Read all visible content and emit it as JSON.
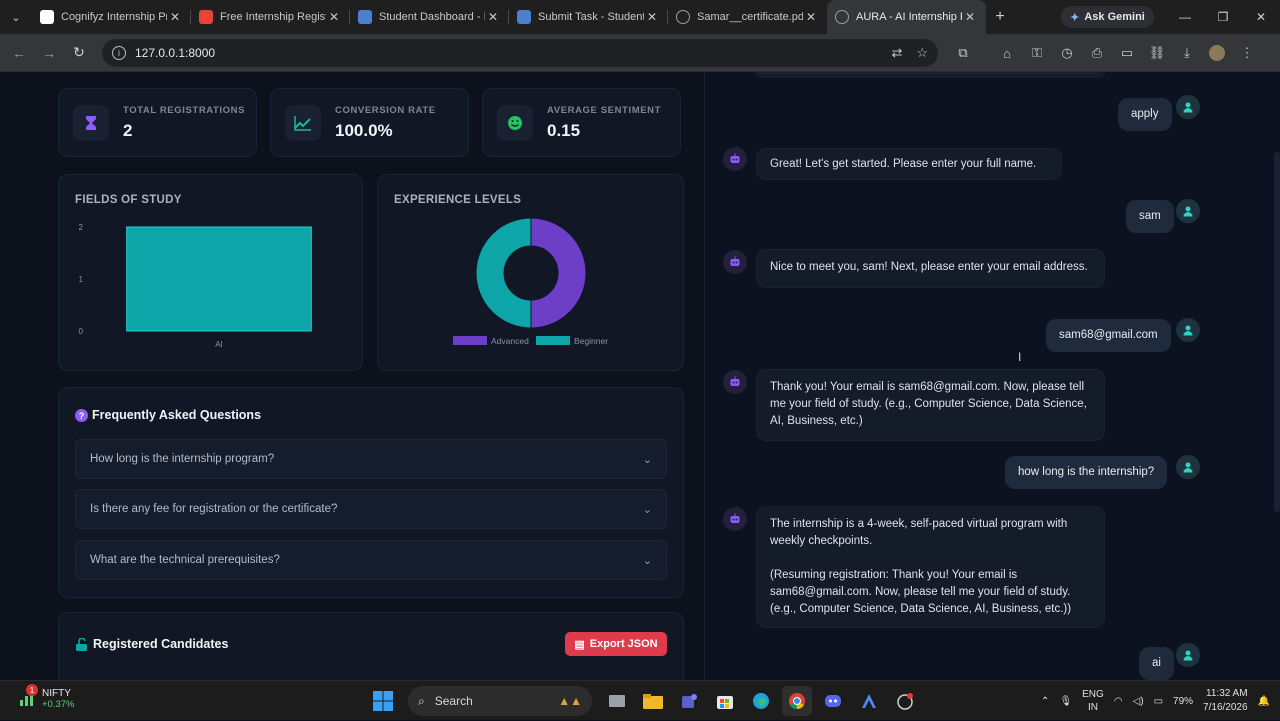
{
  "browser": {
    "tabs": [
      {
        "title": "Cognifyz Internship Pr",
        "color": "#ffffff"
      },
      {
        "title": "Free Internship Registr",
        "color": "#ea4335"
      },
      {
        "title": "Student Dashboard - I",
        "color": "#4a7fd1"
      },
      {
        "title": "Submit Task - Student",
        "color": "#4a7fd1"
      },
      {
        "title": "Samar__certificate.pdf",
        "color": "#9aa0a6"
      },
      {
        "title": "AURA - AI Internship R",
        "color": "#9aa0a6"
      }
    ],
    "active_tab": 5,
    "ask_gemini": "Ask Gemini",
    "url": "127.0.0.1:8000"
  },
  "stats": [
    {
      "label": "TOTAL REGISTRATIONS",
      "value": "2",
      "icon": "hourglass-icon",
      "color": "#8b5cf6"
    },
    {
      "label": "CONVERSION RATE",
      "value": "100.0%",
      "icon": "trending-up-icon",
      "color": "#14b8a6"
    },
    {
      "label": "AVERAGE SENTIMENT",
      "value": "0.15",
      "icon": "smile-icon",
      "color": "#22c55e"
    }
  ],
  "fields_chart": {
    "title": "FIELDS OF STUDY",
    "chart_data": {
      "type": "bar",
      "categories": [
        "AI"
      ],
      "values": [
        2
      ],
      "ylim": [
        0,
        2
      ],
      "yticks": [
        "0",
        "1",
        "2"
      ],
      "color": "#0ea5a8"
    }
  },
  "experience_chart": {
    "title": "EXPERIENCE LEVELS",
    "chart_data": {
      "type": "pie",
      "categories": [
        "Advanced",
        "Beginner"
      ],
      "values": [
        1,
        1
      ],
      "colors": [
        "#6d3fc8",
        "#0ea5a8"
      ]
    }
  },
  "faq": {
    "title": "Frequently Asked Questions",
    "items": [
      "How long is the internship program?",
      "Is there any fee for registration or the certificate?",
      "What are the technical prerequisites?"
    ]
  },
  "candidates": {
    "title": "Registered Candidates",
    "export_label": "Export JSON"
  },
  "chat": [
    {
      "role": "user",
      "text": "apply"
    },
    {
      "role": "bot",
      "text": "Great! Let's get started. Please enter your full name."
    },
    {
      "role": "user",
      "text": "sam"
    },
    {
      "role": "bot",
      "text": "Nice to meet you, sam! Next, please enter your email address."
    },
    {
      "role": "user",
      "text": "sam68@gmail.com"
    },
    {
      "role": "bot",
      "text": "Thank you! Your email is sam68@gmail.com. Now, please tell me your field of study. (e.g., Computer Science, Data Science, AI, Business, etc.)"
    },
    {
      "role": "user",
      "text": "how long is the internship?"
    },
    {
      "role": "bot",
      "text": "The internship is a 4-week, self-paced virtual program with weekly checkpoints."
    },
    {
      "role": "bot_cont",
      "text": "(Resuming registration: Thank you! Your email is sam68@gmail.com. Now, please tell me your field of study. (e.g., Computer Science, Data Science, AI, Business, etc.))"
    },
    {
      "role": "user",
      "text": "ai"
    }
  ],
  "taskbar": {
    "ticker": "NIFTY",
    "ticker_change": "+0.37%",
    "ticker_badge": "1",
    "search": "Search",
    "lang1": "ENG",
    "lang2": "IN",
    "battery": "79%",
    "time": "11:32 AM",
    "date": "7/16/2026"
  }
}
